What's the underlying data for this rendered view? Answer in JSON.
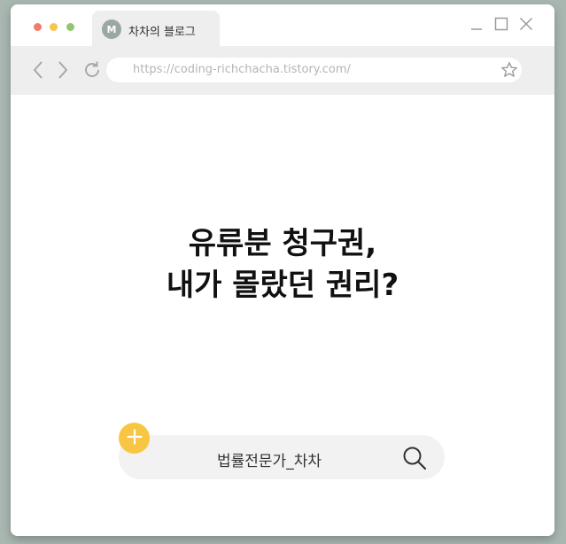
{
  "tab": {
    "avatar_letter": "M",
    "title": "차차의 블로그"
  },
  "address_bar": {
    "url": "https://coding-richchacha.tistory.com/"
  },
  "icons": {
    "window_dots": [
      "close-dot",
      "minimize-dot",
      "maximize-dot"
    ],
    "window_controls": [
      "minimize-icon",
      "maximize-icon",
      "close-icon"
    ],
    "navigation": [
      "back-icon",
      "forward-icon",
      "reload-icon"
    ],
    "address_bar": [
      "star-icon"
    ],
    "search": [
      "search-icon"
    ],
    "plus": [
      "plus-icon"
    ]
  },
  "colors": {
    "dot_red": "#f17c68",
    "dot_yellow": "#f5c54c",
    "dot_green": "#93c66b",
    "accent_yellow": "#f8c642",
    "background": "#a9b7b1"
  },
  "main": {
    "headline_line1": "유류분 청구권,",
    "headline_line2": "내가 몰랐던 권리?"
  },
  "search": {
    "label": "법률전문가_차차"
  }
}
